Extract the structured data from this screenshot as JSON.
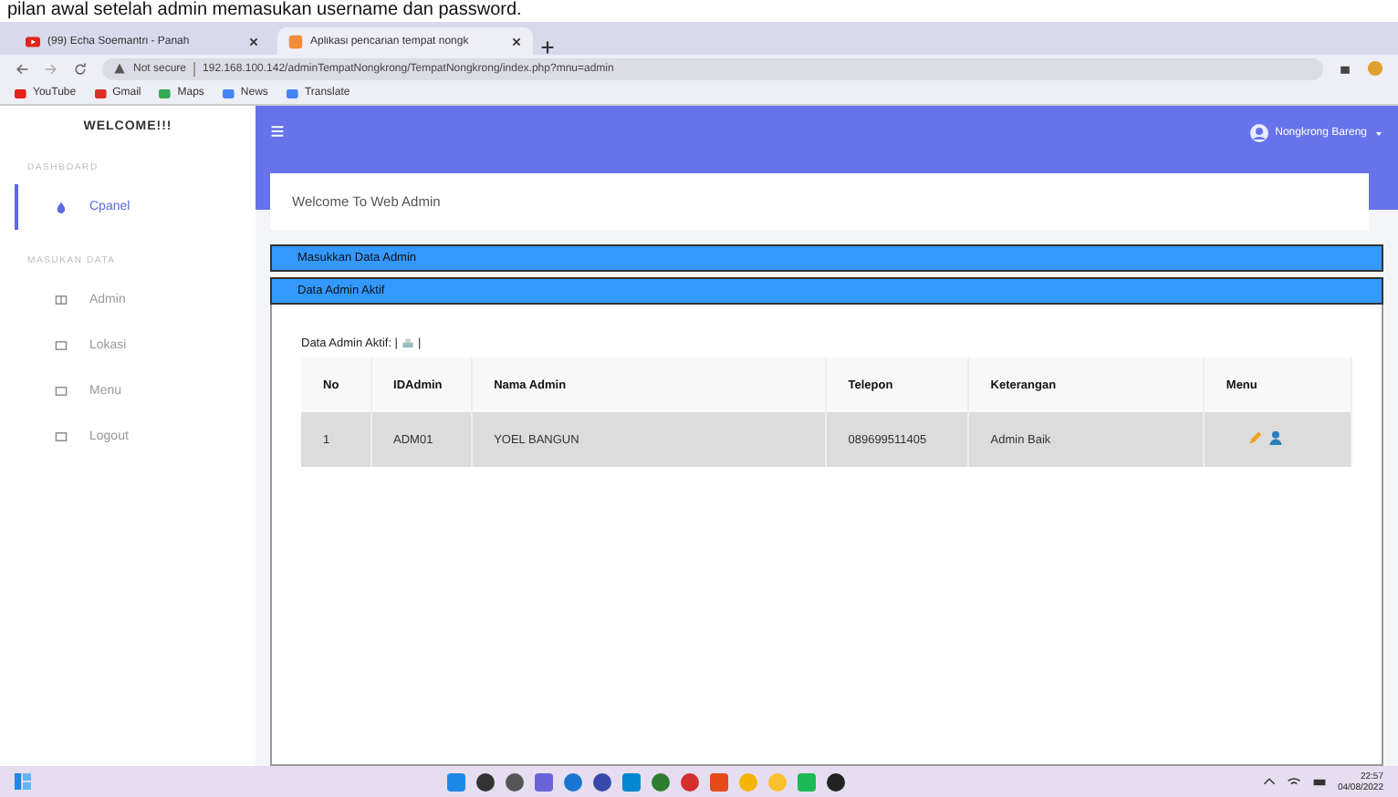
{
  "caption": "pilan awal setelah admin memasukan username dan password.",
  "browser": {
    "tabs": [
      {
        "title": "(99) Echa Soemantri - Panah",
        "selected": false,
        "kind": "video"
      },
      {
        "title": "Aplikasi pencarian tempat nongk",
        "selected": true,
        "kind": "app"
      }
    ],
    "security": "Not secure",
    "url": "192.168.100.142/adminTempatNongkrong/TempatNongkrong/index.php?mnu=admin",
    "bookmarks": [
      "YouTube",
      "Gmail",
      "Maps",
      "News",
      "Translate"
    ]
  },
  "sidebar": {
    "title": "WELCOME!!!",
    "sections": [
      {
        "heading": "DASHBOARD",
        "items": [
          {
            "label": "Cpanel",
            "selected": true
          }
        ]
      },
      {
        "heading": "MASUKAN DATA",
        "items": [
          {
            "label": "Admin",
            "selected": false
          },
          {
            "label": "Lokasi",
            "selected": false
          },
          {
            "label": "Menu",
            "selected": false
          },
          {
            "label": "Logout",
            "selected": false
          }
        ]
      }
    ]
  },
  "user": "Nongkrong Bareng",
  "welcome": "Welcome To Web Admin",
  "bars": [
    "Masukkan Data Admin",
    "Data Admin Aktif"
  ],
  "panel_label": "Data Admin Aktif: |",
  "panel_label_end": "|",
  "table": {
    "columns": [
      "No",
      "IDAdmin",
      "Nama Admin",
      "Telepon",
      "Keterangan",
      "Menu"
    ],
    "rows": [
      [
        "1",
        "ADM01",
        "YOEL BANGUN",
        "089699511405",
        "Admin Baik"
      ]
    ]
  },
  "taskbar": {
    "time": "22:57",
    "date": "04/08/2022"
  }
}
